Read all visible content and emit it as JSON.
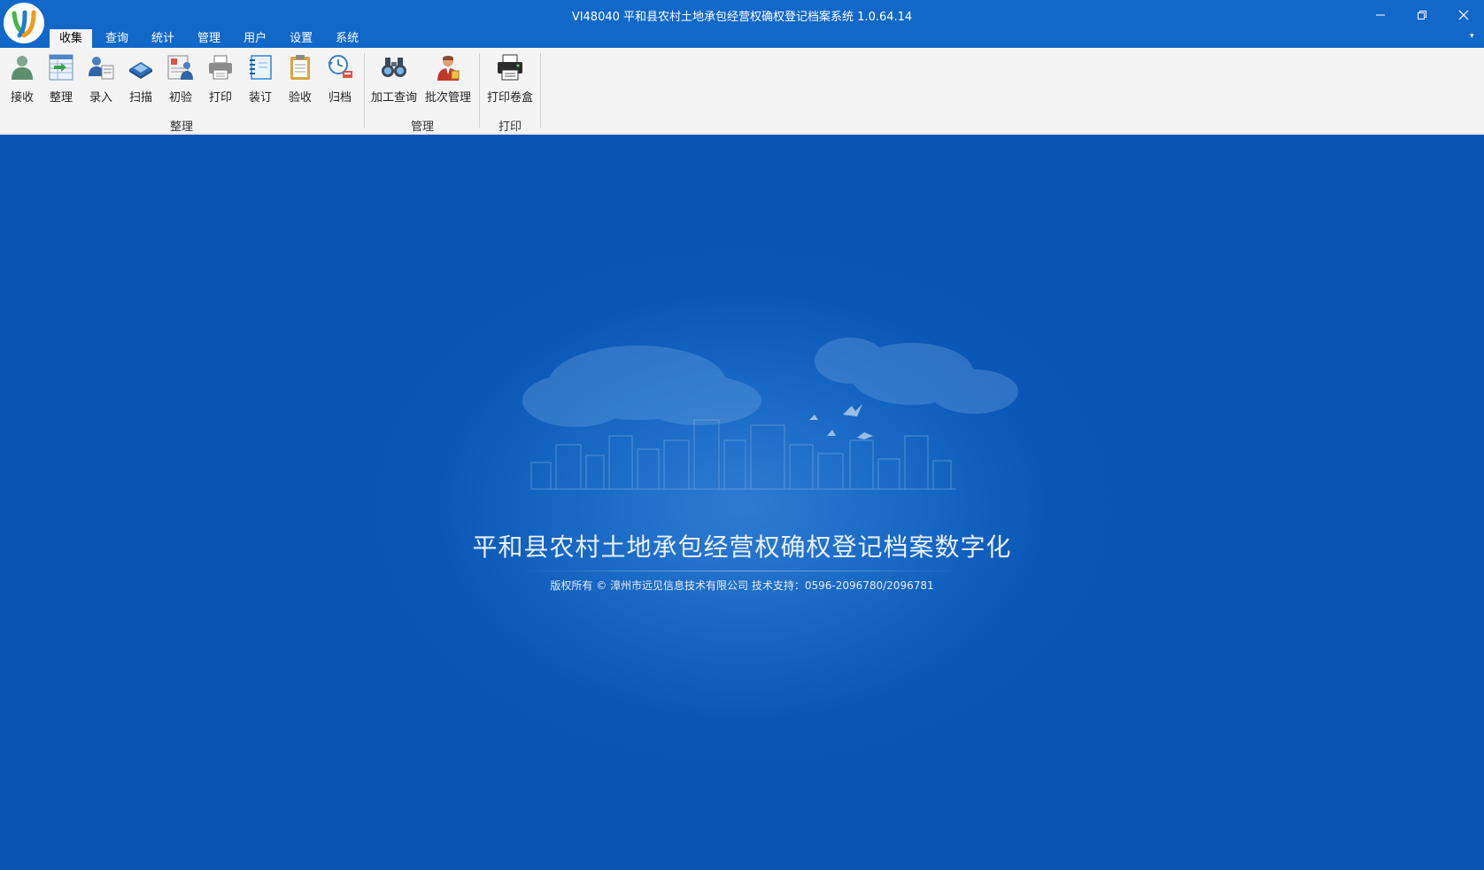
{
  "window": {
    "title": "VI48040 平和县农村土地承包经营权确权登记档案系统 1.0.64.14",
    "logo_text": "YJ"
  },
  "tabs": [
    {
      "label": "收集",
      "active": true
    },
    {
      "label": "查询"
    },
    {
      "label": "统计"
    },
    {
      "label": "管理"
    },
    {
      "label": "用户"
    },
    {
      "label": "设置"
    },
    {
      "label": "系统"
    }
  ],
  "ribbon": {
    "groups": [
      {
        "label": "整理",
        "buttons": [
          {
            "label": "接收",
            "icon": "user-receive-icon"
          },
          {
            "label": "整理",
            "icon": "table-organize-icon"
          },
          {
            "label": "录入",
            "icon": "user-entry-icon"
          },
          {
            "label": "扫描",
            "icon": "scanner-icon"
          },
          {
            "label": "初验",
            "icon": "initial-check-icon"
          },
          {
            "label": "打印",
            "icon": "printer-icon"
          },
          {
            "label": "装订",
            "icon": "binder-icon"
          },
          {
            "label": "验收",
            "icon": "clipboard-icon"
          },
          {
            "label": "归档",
            "icon": "archive-clock-icon"
          }
        ]
      },
      {
        "label": "管理",
        "buttons": [
          {
            "label": "加工查询",
            "icon": "binoculars-icon"
          },
          {
            "label": "批次管理",
            "icon": "batch-manager-icon"
          }
        ]
      },
      {
        "label": "打印",
        "buttons": [
          {
            "label": "打印卷盒",
            "icon": "box-printer-icon"
          }
        ]
      }
    ]
  },
  "splash": {
    "title": "平和县农村土地承包经营权确权登记档案数字化",
    "copyright": "版权所有 © 漳州市远见信息技术有限公司 技术支持：0596-2096780/2096781"
  },
  "colors": {
    "titlebar": "#1168c9",
    "ribbon_bg": "#f4f4f4",
    "main_bg": "#0a56b4"
  }
}
